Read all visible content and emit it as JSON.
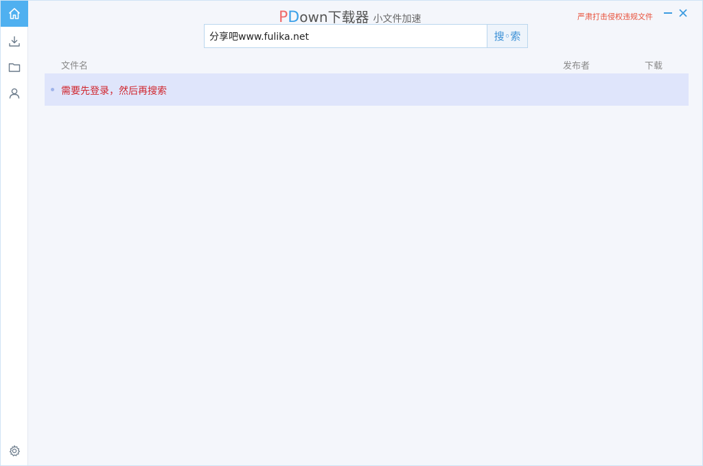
{
  "app": {
    "title_p": "P",
    "title_d": "D",
    "title_rest": "own下载器",
    "subtitle": "小文件加速",
    "notice": "严肃打击侵权违规文件"
  },
  "sidebar": {
    "items": [
      {
        "name": "home",
        "icon": "home-icon",
        "active": true
      },
      {
        "name": "download",
        "icon": "download-icon",
        "active": false
      },
      {
        "name": "folder",
        "icon": "folder-icon",
        "active": false
      },
      {
        "name": "user",
        "icon": "user-icon",
        "active": false
      },
      {
        "name": "settings",
        "icon": "gear-icon",
        "active": false
      }
    ]
  },
  "search": {
    "value": "分享吧www.fulika.net",
    "button_label": "搜◦索"
  },
  "table": {
    "columns": [
      "文件名",
      "发布者",
      "下载"
    ],
    "rows": [
      {
        "message": "需要先登录，然后再搜索"
      }
    ]
  },
  "colors": {
    "accent": "#4fb0f0",
    "title_p": "#f06a6a",
    "title_d": "#3aa0e8",
    "notice": "#e8503a",
    "error_text": "#d0262e",
    "row_bg": "#dfe5fb"
  }
}
